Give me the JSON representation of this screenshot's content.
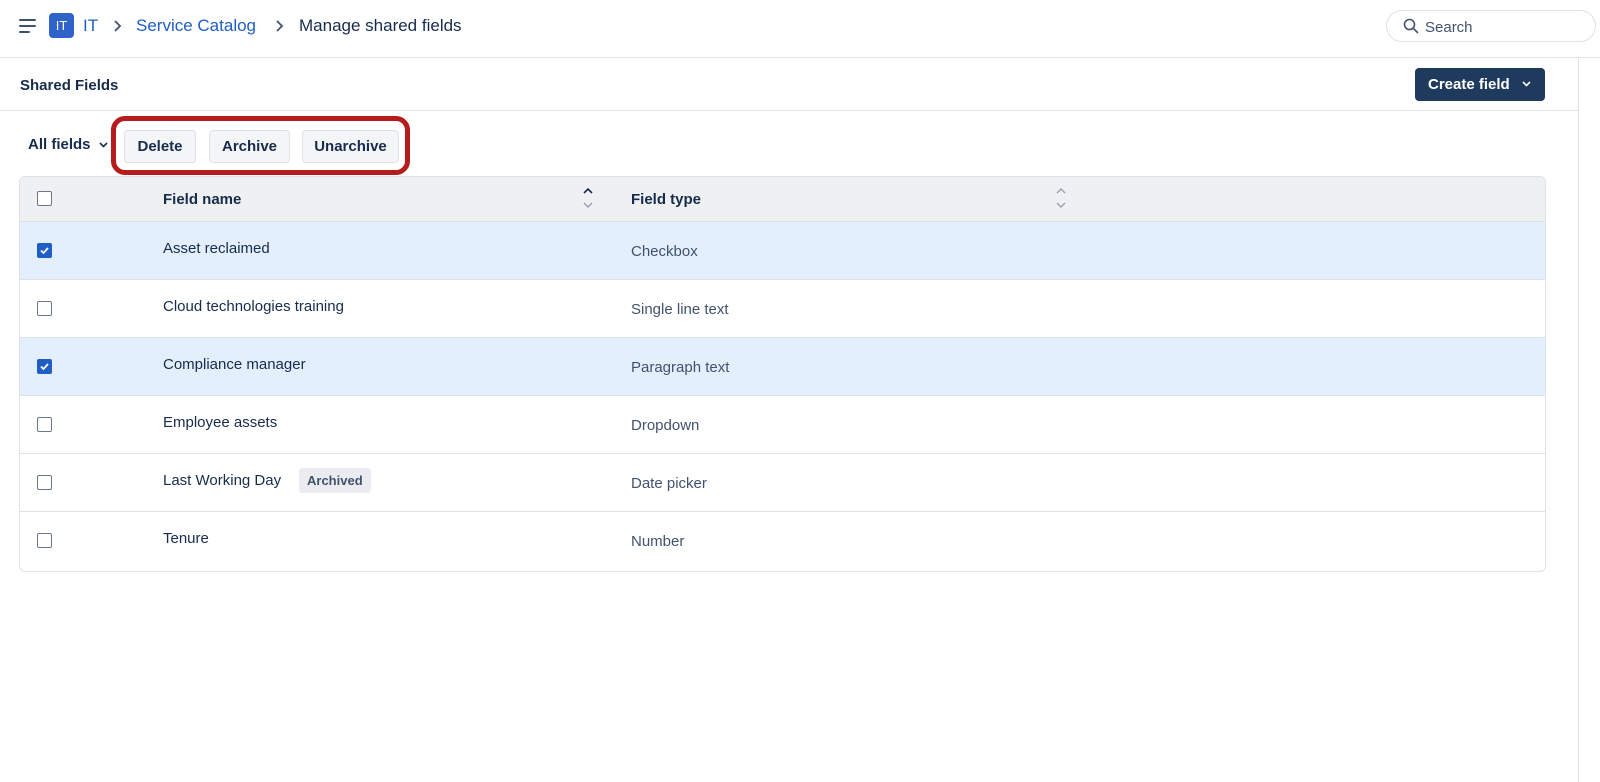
{
  "header": {
    "menu_icon": "hamburger-menu-icon",
    "app_badge": "IT",
    "breadcrumbs": [
      {
        "label": "IT"
      },
      {
        "label": "Service Catalog"
      },
      {
        "label": "Manage shared fields"
      }
    ],
    "search": {
      "placeholder": "Search",
      "value": ""
    }
  },
  "page": {
    "title": "Shared Fields",
    "create_button": "Create field"
  },
  "toolbar": {
    "filter_label": "All fields",
    "actions": [
      "Delete",
      "Archive",
      "Unarchive"
    ]
  },
  "table": {
    "columns": [
      "Field name",
      "Field type"
    ],
    "rows": [
      {
        "name": "Asset reclaimed",
        "type": "Checkbox",
        "checked": true,
        "badge": ""
      },
      {
        "name": "Cloud technologies training",
        "type": "Single line text",
        "checked": false,
        "badge": ""
      },
      {
        "name": "Compliance manager",
        "type": "Paragraph text",
        "checked": true,
        "badge": ""
      },
      {
        "name": "Employee assets",
        "type": "Dropdown",
        "checked": false,
        "badge": ""
      },
      {
        "name": "Last Working Day",
        "type": "Date picker",
        "checked": false,
        "badge": "Archived"
      },
      {
        "name": "Tenure",
        "type": "Number",
        "checked": false,
        "badge": ""
      }
    ]
  },
  "colors": {
    "accent": "#1f5ec2",
    "primary_button": "#1e3a5c",
    "selected_row": "#e3effd",
    "highlight": "#b71c1c"
  }
}
